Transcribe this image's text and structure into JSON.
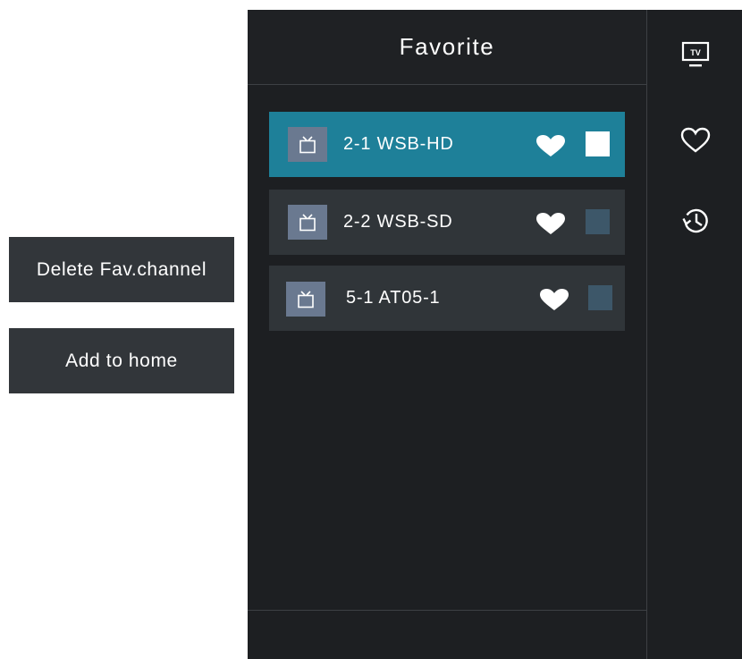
{
  "actions": {
    "delete_label": "Delete Fav.channel",
    "add_home_label": "Add to home"
  },
  "panel": {
    "title": "Favorite"
  },
  "channels": [
    {
      "name": "2-1 WSB-HD",
      "favorite": true,
      "checked": true,
      "selected": true
    },
    {
      "name": "2-2 WSB-SD",
      "favorite": true,
      "checked": false,
      "selected": false
    },
    {
      "name": "5-1 AT05-1",
      "favorite": true,
      "checked": false,
      "selected": false
    }
  ],
  "side_nav": {
    "tv_icon_text": "TV",
    "items": [
      {
        "icon": "tv-icon"
      },
      {
        "icon": "heart-outline-icon"
      },
      {
        "icon": "history-icon"
      }
    ]
  },
  "colors": {
    "selected_row": "#1e8099",
    "row": "#303539",
    "panel": "#1d1f22",
    "button": "#32363a",
    "channel_icon_bg": "#6a7990",
    "checkbox_unchecked": "#3d5769"
  }
}
